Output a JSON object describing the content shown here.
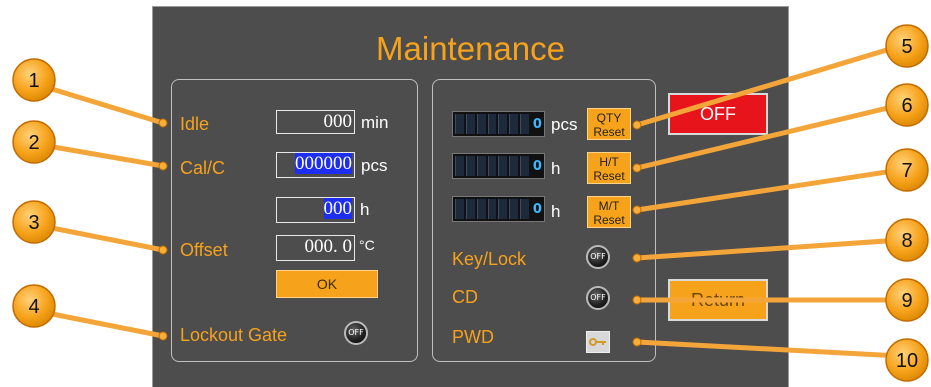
{
  "title": "Maintenance",
  "left": {
    "idle": {
      "label": "Idle",
      "value": "000",
      "unit": "min"
    },
    "calc": {
      "label": "Cal/C",
      "value": "000000",
      "unit": "pcs"
    },
    "hours": {
      "value": "000",
      "unit": "h"
    },
    "offset": {
      "label": "Offset",
      "value": "000. 0",
      "unit": "°C"
    },
    "ok_label": "OK",
    "lockout": {
      "label": "Lockout Gate",
      "toggle": "OFF"
    }
  },
  "right": {
    "counters": [
      {
        "digit": "0",
        "unit": "pcs",
        "reset_line1": "QTY",
        "reset_line2": "Reset"
      },
      {
        "digit": "0",
        "unit": "h",
        "reset_line1": "H/T",
        "reset_line2": "Reset"
      },
      {
        "digit": "0",
        "unit": "h",
        "reset_line1": "M/T",
        "reset_line2": "Reset"
      }
    ],
    "keylock": {
      "label": "Key/Lock",
      "toggle": "OFF"
    },
    "cd": {
      "label": "CD",
      "toggle": "OFF"
    },
    "pwd": {
      "label": "PWD",
      "icon": "key-icon"
    }
  },
  "off_label": "OFF",
  "return_label": "Return",
  "callouts": [
    "1",
    "2",
    "3",
    "4",
    "5",
    "6",
    "7",
    "8",
    "9",
    "10"
  ],
  "colors": {
    "accent": "#f7a21b",
    "panel": "#4d4d4d",
    "off": "#e8141c",
    "highlight": "#1d2ef0"
  }
}
